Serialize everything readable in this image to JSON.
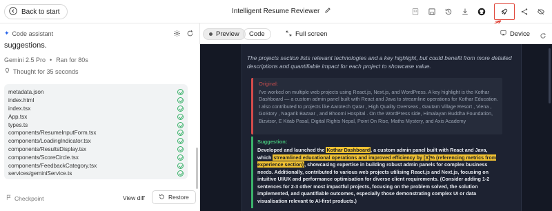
{
  "header": {
    "back_label": "Back to start",
    "title": "Intelligent Resume Reviewer",
    "icons": [
      "image-icon",
      "save-icon",
      "history-icon",
      "download-icon",
      "github-icon",
      "deploy-rocket-icon",
      "share-icon",
      "hide-sidebar-icon"
    ]
  },
  "assistant": {
    "label": "Code assistant",
    "lead_text": "suggestions.",
    "model": "Gemini 2.5 Pro",
    "run_info": "Ran for 80s",
    "thought": "Thought for 35 seconds",
    "files": [
      "metadata.json",
      "index.html",
      "index.tsx",
      "App.tsx",
      "types.ts",
      "components/ResumeInputForm.tsx",
      "components/LoadingIndicator.tsx",
      "components/ResultsDisplay.tsx",
      "components/ScoreCircle.tsx",
      "components/FeedbackCategory.tsx",
      "services/geminiService.ts"
    ],
    "checkpoint": "Checkpoint",
    "view_diff": "View diff",
    "restore": "Restore"
  },
  "tabs": {
    "preview": "Preview",
    "code": "Code",
    "full_screen": "Full screen",
    "device": "Device"
  },
  "preview": {
    "intro": "The projects section lists relevant technologies and a key highlight, but could benefit from more detailed descriptions and quantifiable impact for each project to showcase value.",
    "original_label": "Original:",
    "original_text": "I've worked on multiple web projects using React.js, Next.js, and WordPress. A key highlight is the Kothar Dashboard — a custom admin panel built with React and Java to streamline operations for Kothar Education. I also contributed to projects like Aarotech Qatar , High Quality Overseas , Gautam Village Resort , Viena , GoStory , Nagarik Bazaar , and Bhoomi Hospital . On the WordPress side, Himalayan Buddha Foundation, Bizvisor, E Kitab Pasal, Digital Rights Nepal, Point On Rise, Maths Mystery, and Axis Academy",
    "suggestion_label": "Suggestion:",
    "suggestion_parts": {
      "p1": "Developed and launched the ",
      "h1": "Kothar Dashboard",
      "p2": ", a custom admin panel built with React and Java, which ",
      "h2": "streamlined educational operations and improved efficiency by [X]% (referencing metrics from experience section)",
      "p3": ", showcasing expertise in building robust admin panels for complex business needs. Additionally, contributed to various web projects utilising React.js and Next.js, focusing on intuitive UI/UX and performance optimisation for diverse client requirements. (Consider adding 1-2 sentences for 2-3 other most impactful projects, focusing on the problem solved, the solution implemented, and quantifiable outcomes, especially those demonstrating complex UI or data visualisation relevant to AI-first products.)"
    }
  },
  "colors": {
    "accent_red": "#e0463a",
    "preview_bg": "#141824",
    "success": "#3bb36b",
    "highlight": "#f1c232"
  }
}
